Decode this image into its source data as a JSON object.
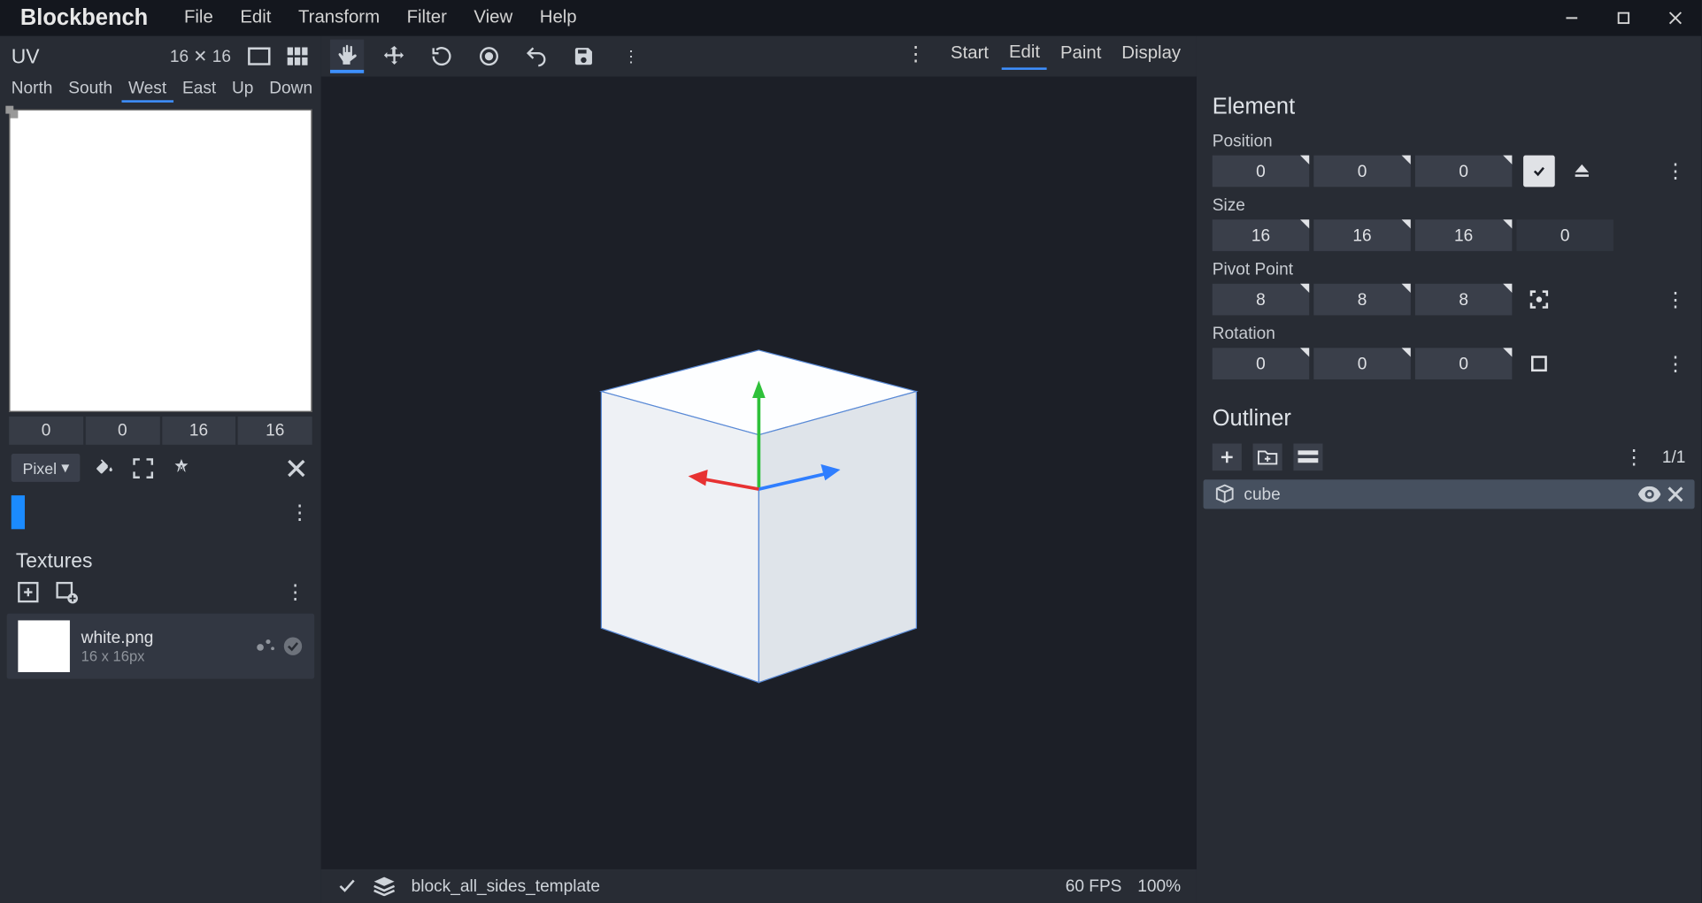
{
  "brand": "Blockbench",
  "menu": [
    "File",
    "Edit",
    "Transform",
    "Filter",
    "View",
    "Help"
  ],
  "modes": {
    "items": [
      "Start",
      "Edit",
      "Paint",
      "Display"
    ],
    "active": "Edit"
  },
  "uv": {
    "title": "UV",
    "resolution": "16 ✕ 16",
    "faces": [
      "North",
      "South",
      "West",
      "East",
      "Up",
      "Down"
    ],
    "active_face": "West",
    "coords": [
      "0",
      "0",
      "16",
      "16"
    ],
    "snap_label": "Pixel"
  },
  "textures": {
    "title": "Textures",
    "items": [
      {
        "name": "white.png",
        "dim": "16 x 16px"
      }
    ]
  },
  "element": {
    "title": "Element",
    "position": {
      "label": "Position",
      "x": "0",
      "y": "0",
      "z": "0"
    },
    "size": {
      "label": "Size",
      "x": "16",
      "y": "16",
      "z": "16",
      "inflate": "0"
    },
    "pivot": {
      "label": "Pivot Point",
      "x": "8",
      "y": "8",
      "z": "8"
    },
    "rotation": {
      "label": "Rotation",
      "x": "0",
      "y": "0",
      "z": "0"
    }
  },
  "outliner": {
    "title": "Outliner",
    "count": "1/1",
    "items": [
      {
        "name": "cube"
      }
    ]
  },
  "status": {
    "project": "block_all_sides_template",
    "fps": "60 FPS",
    "zoom": "100%"
  }
}
